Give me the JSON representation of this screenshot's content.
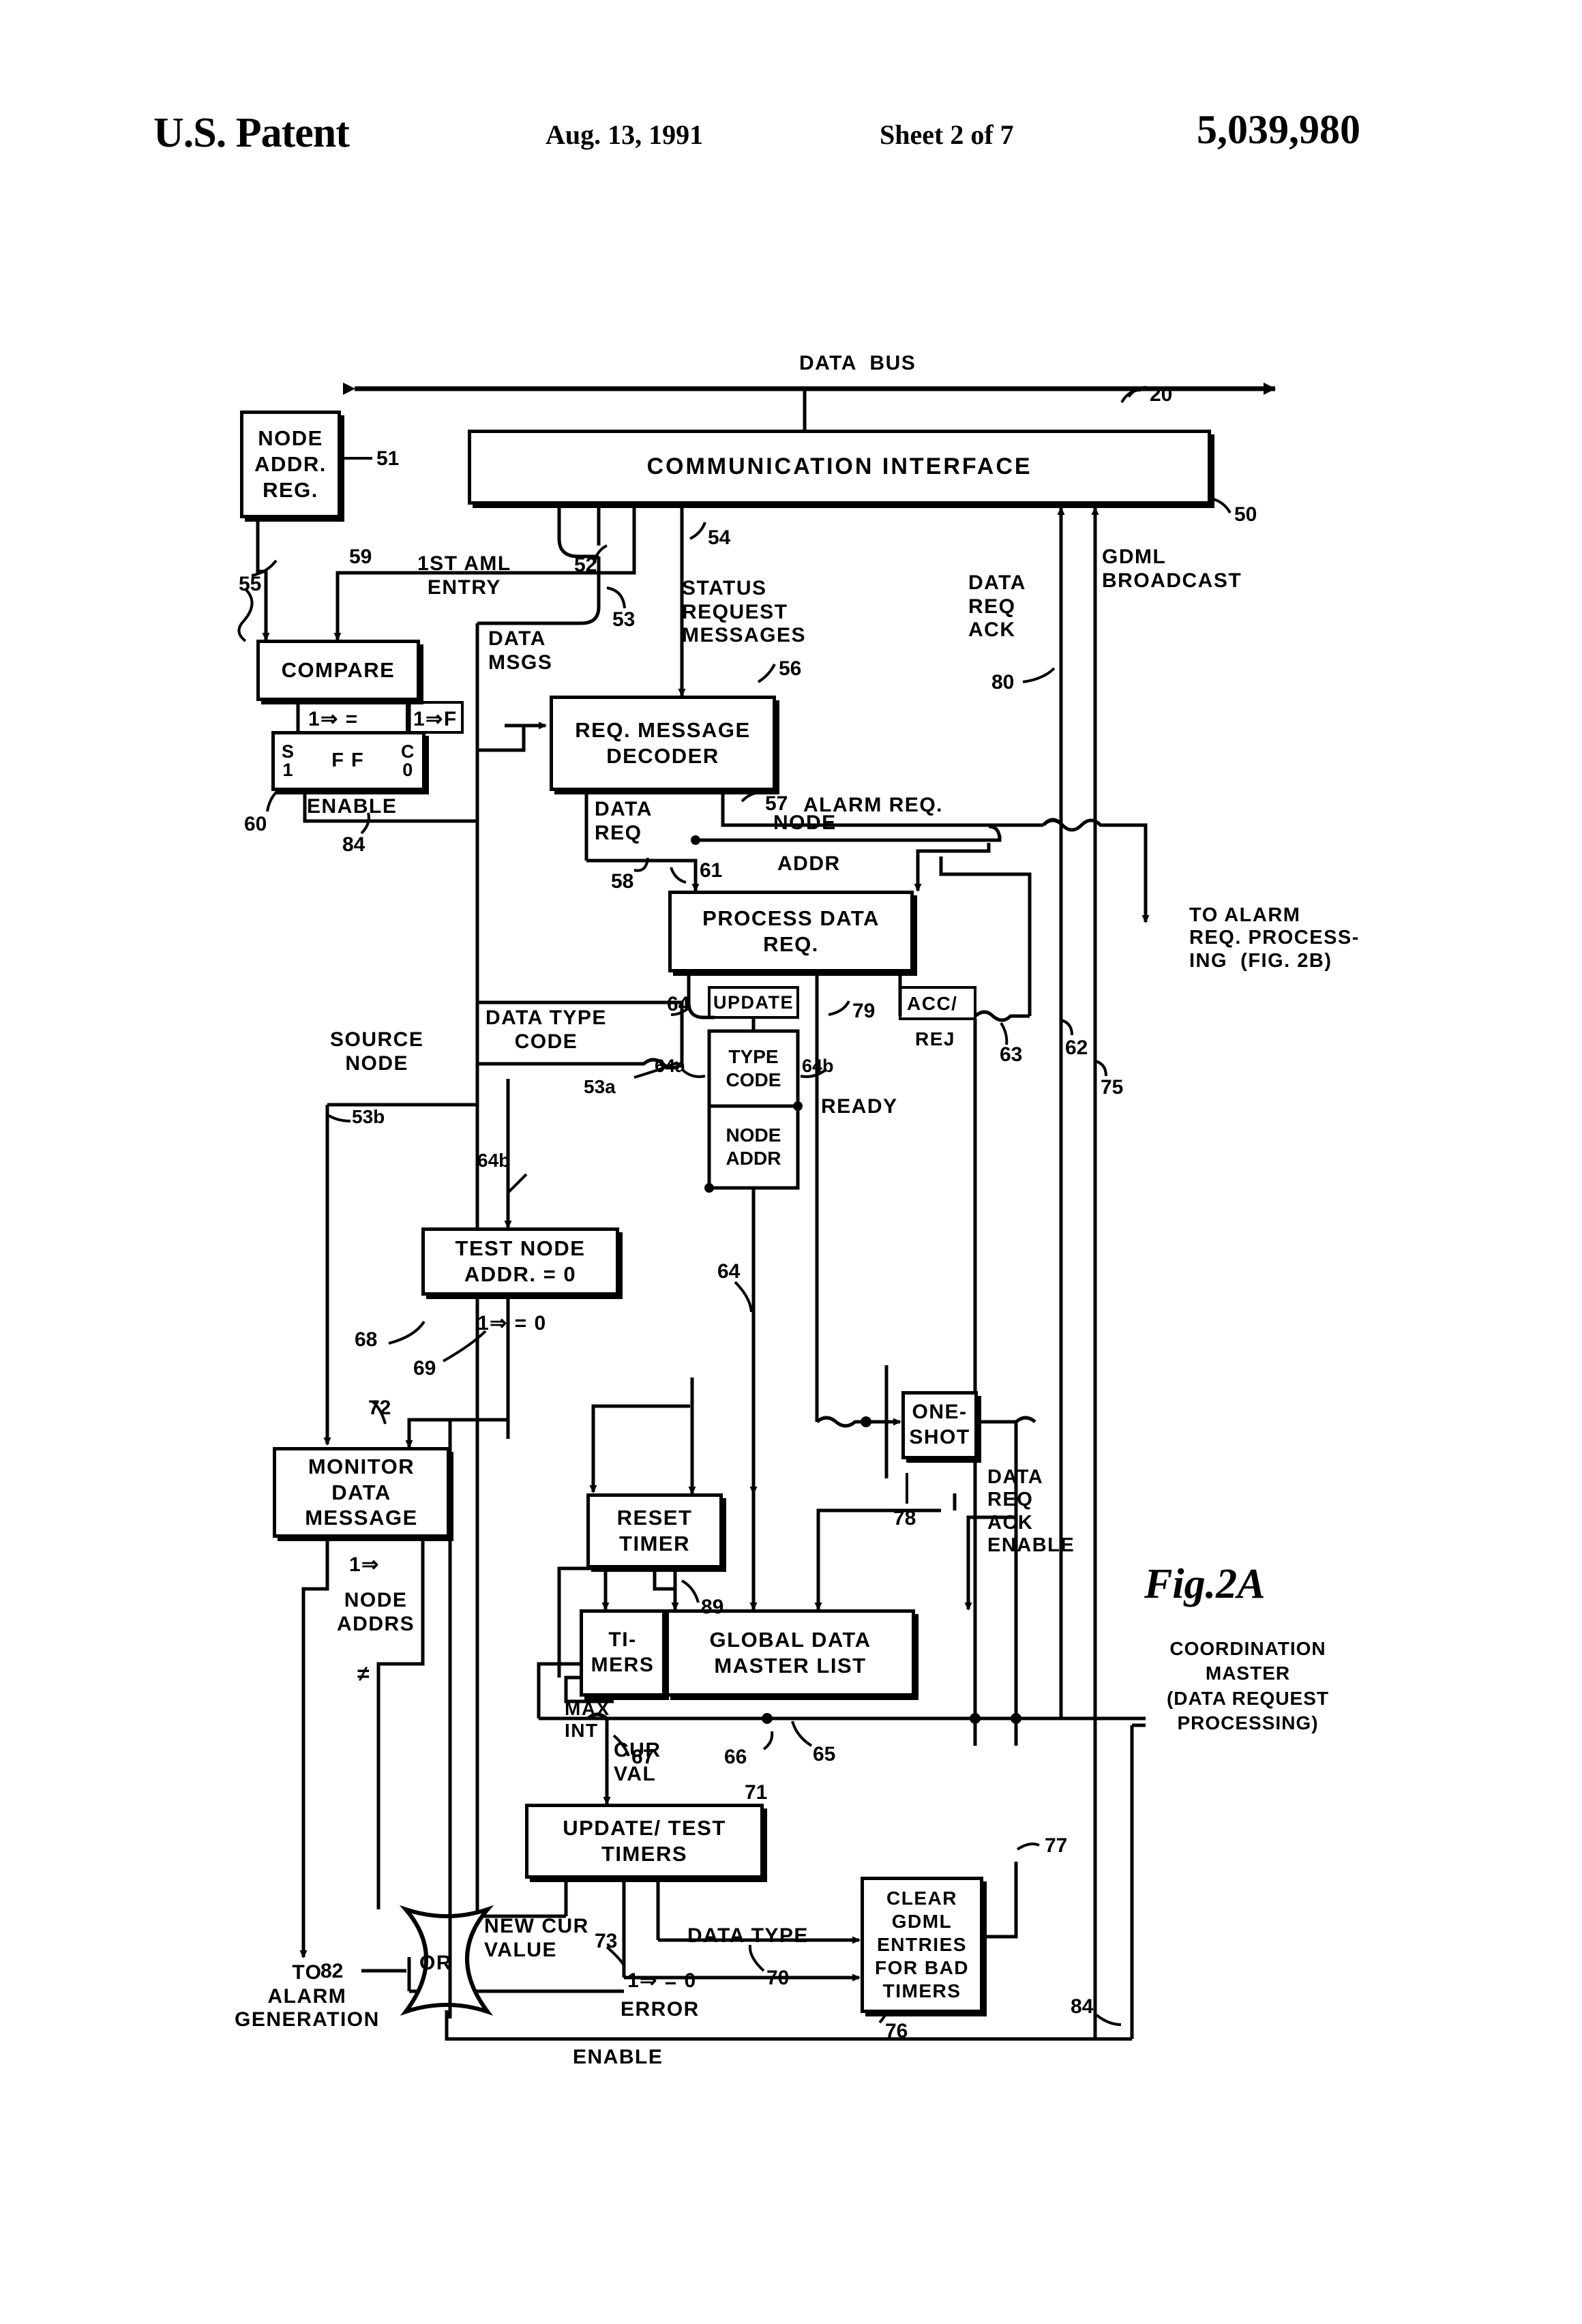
{
  "header": {
    "office": "U.S. Patent",
    "date": "Aug. 13, 1991",
    "sheet": "Sheet 2 of 7",
    "patent_number": "5,039,980"
  },
  "figure": {
    "label": "Fig.2A",
    "caption": "COORDINATION\nMASTER\n(DATA REQUEST\nPROCESSING)"
  },
  "boxes": {
    "node_addr_reg": "NODE\nADDR.\nREG.",
    "communication_interface": "COMMUNICATION     INTERFACE",
    "compare": "COMPARE",
    "ff_s": "S\n1",
    "ff_label": "F F",
    "ff_c": "C\n0",
    "req_message_decoder": "REQ. MESSAGE\nDECODER",
    "process_data_req": "PROCESS\nDATA REQ.",
    "type_code": "TYPE\nCODE",
    "node_addr": "NODE\nADDR",
    "test_node_addr": "TEST NODE\nADDR. = 0",
    "monitor_data_message": "MONITOR\nDATA\nMESSAGE",
    "one_shot": "ONE-\nSHOT",
    "reset_timer": "RESET\nTIMER",
    "timers": "TI-\nMERS",
    "global_data_master_list": "GLOBAL  DATA\nMASTER LIST",
    "update_test_timers": "UPDATE/ TEST\nTIMERS",
    "clear_gdml": "CLEAR\nGDML\nENTRIES\nFOR BAD\nTIMERS",
    "or_gate": "OR"
  },
  "signals": {
    "data_bus": "DATA  BUS",
    "first_aml_entry": "1ST AML\nENTRY",
    "data_msgs": "DATA\nMSGS",
    "status_request_messages": "STATUS\nREQUEST\nMESSAGES",
    "data_req_ack": "DATA\nREQ\nACK",
    "gdml_broadcast": "GDML\nBROADCAST",
    "enable_ff": "ENABLE",
    "data_req": "DATA\nREQ",
    "alarm_req": "ALARM REQ.",
    "node_addr_sig": "NODE",
    "addr_sig": "ADDR",
    "to_alarm_req_processing": "TO ALARM\nREQ. PROCESS-\nING  (FIG. 2B)",
    "update": "UPDATE",
    "acc_rej": "ACC/",
    "rej": "REJ",
    "ready": "READY",
    "source_node": "SOURCE\nNODE",
    "data_type_code": "DATA TYPE\nCODE",
    "node_addrs_neq": "NODE\nADDRS",
    "data_req_ack_enable": "DATA\nREQ\nACK\nENABLE",
    "max_int": "MAX\nINT",
    "cur_val": "CUR\nVAL",
    "new_cur_value": "NEW CUR\nVALUE",
    "data_type": "DATA TYPE",
    "error": "ERROR",
    "enable_bottom": "ENABLE",
    "to_alarm_generation": "TO\nALARM\nGENERATION",
    "eq_true": "1⇒ =",
    "eq_false": "1⇒F",
    "eq_zero_1": "1⇒ = 0",
    "eq_zero_2": "1⇒ = 0",
    "implies": "1⇒",
    "not_equal": "≠"
  },
  "reference_numerals": {
    "n20": "20",
    "n50": "50",
    "n51": "51",
    "n52": "52",
    "n53": "53",
    "n53a": "53a",
    "n53b": "53b",
    "n54": "54",
    "n55": "55",
    "n56": "56",
    "n57": "57",
    "n58": "58",
    "n59": "59",
    "n60": "60",
    "n61": "61",
    "n62": "62",
    "n63": "63",
    "n64": "64",
    "n64a": "64a",
    "n64b_right": "64b",
    "n64b_left": "64b",
    "n64_mid": "64",
    "n65": "65",
    "n66": "66",
    "n67": "67",
    "n68": "68",
    "n69": "69",
    "n70": "70",
    "n71": "71",
    "n72": "72",
    "n73": "73",
    "n75": "75",
    "n76": "76",
    "n77": "77",
    "n78_oneshot": "78",
    "n79": "79",
    "n80": "80",
    "n82": "82",
    "n84_top": "84",
    "n84_bottom": "84",
    "n89": "89"
  }
}
